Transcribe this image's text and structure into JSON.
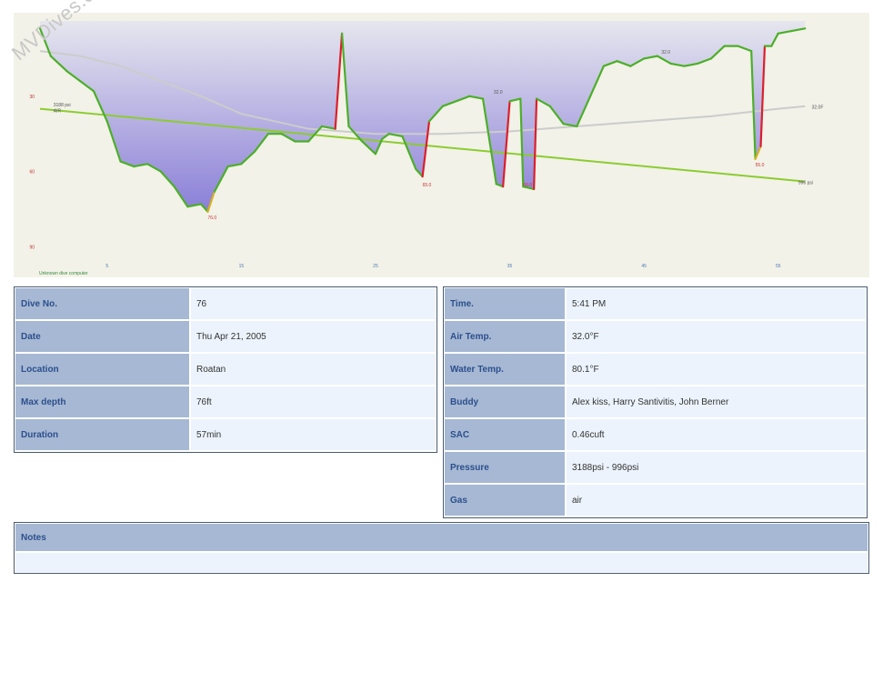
{
  "watermark": "MVDives.com",
  "chart_data": {
    "type": "line",
    "x_ticks": [
      5,
      15,
      25,
      35,
      45,
      55
    ],
    "y_ticks": [
      30,
      60,
      90
    ],
    "xlim": [
      0,
      58
    ],
    "ylim": [
      0,
      100
    ],
    "series": [
      {
        "kind": "depth",
        "x": [
          0,
          0.8,
          2,
          3,
          4,
          5,
          6,
          7,
          8,
          9,
          10,
          11,
          12,
          12.5,
          13,
          14,
          15,
          16,
          17,
          18,
          19,
          20,
          21,
          22,
          22.5,
          23,
          24,
          25,
          25.5,
          26,
          27,
          28,
          28.5,
          29,
          30,
          31,
          32,
          33,
          34,
          34.5,
          35,
          35.8,
          36,
          36.8,
          37,
          38,
          39,
          40,
          41,
          42,
          43,
          44,
          45,
          46,
          47,
          48,
          49,
          50,
          51,
          52,
          53,
          53.3,
          53.7,
          54,
          54.5,
          55,
          56,
          57
        ],
        "y": [
          3,
          14,
          20,
          24,
          28,
          40,
          56,
          58,
          57,
          60,
          66,
          74,
          73,
          76,
          68,
          58,
          57,
          52,
          45,
          45,
          48,
          48,
          42,
          43,
          5,
          42,
          48,
          53,
          47,
          45,
          46,
          59,
          62,
          40,
          34,
          32,
          30,
          31,
          65,
          66,
          32,
          31,
          66,
          67,
          31,
          34,
          41,
          42,
          30,
          18,
          16,
          18,
          15,
          14,
          17,
          18,
          17,
          15,
          10,
          10,
          12,
          55,
          50,
          10,
          10,
          5,
          4,
          3
        ]
      },
      {
        "kind": "pressure",
        "x": [
          0,
          57
        ],
        "y": [
          35,
          64
        ]
      },
      {
        "kind": "temperature",
        "x": [
          0,
          3,
          6,
          9,
          12,
          15,
          20,
          25,
          30,
          35,
          40,
          45,
          50,
          55,
          57
        ],
        "y": [
          12,
          14,
          18,
          24,
          30,
          37,
          43,
          45,
          45,
          44,
          42,
          40,
          38,
          35,
          34
        ]
      }
    ],
    "labels": [
      {
        "x": 1,
        "y": 34,
        "text": "3188 psi",
        "color": "#555555"
      },
      {
        "x": 1,
        "y": 36.5,
        "text": "AIR",
        "color": "#555555"
      },
      {
        "x": 12.5,
        "y": 79,
        "text": "76.0",
        "color": "#cc3333"
      },
      {
        "x": 28.5,
        "y": 66,
        "text": "65.0",
        "color": "#cc3333"
      },
      {
        "x": 36,
        "y": 66,
        "text": "66.0",
        "color": "#cc3333"
      },
      {
        "x": 53.3,
        "y": 58,
        "text": "55.0",
        "color": "#cc3333"
      },
      {
        "x": 56.5,
        "y": 65,
        "text": "996 psi",
        "color": "#555555"
      },
      {
        "x": 57.5,
        "y": 35,
        "text": "32.0F",
        "color": "#555555"
      },
      {
        "x": 33.8,
        "y": 29,
        "text": "32.0",
        "color": "#555555"
      },
      {
        "x": 46.3,
        "y": 13,
        "text": "32.0",
        "color": "#555555"
      }
    ],
    "footer": "Unknown dive computer",
    "colors": {
      "background": "#f2f2e8",
      "depth_fill_top": "#e0e0ea",
      "depth_fill_bottom": "#8c80d8",
      "depth_line": "#4caf28",
      "depth_line_dark": "#1e6b1e",
      "ascent_fast": "#dd1f2a",
      "ascent_mid": "#d8b020",
      "pressure": "#8ccc30",
      "temperature": "#cccccc",
      "axis_label": "#4a78b4",
      "axis_label_red": "#c03030"
    }
  },
  "dive_info": [
    {
      "label": "Dive No.",
      "value": "76"
    },
    {
      "label": "Date",
      "value": "Thu Apr 21, 2005"
    },
    {
      "label": "Location",
      "value": "Roatan"
    },
    {
      "label": "Max depth",
      "value": "76ft"
    },
    {
      "label": "Duration",
      "value": "57min"
    }
  ],
  "dive_details": [
    {
      "label": "Time.",
      "value": "5:41 PM"
    },
    {
      "label": "Air Temp.",
      "value": "32.0°F"
    },
    {
      "label": "Water Temp.",
      "value": "80.1°F"
    },
    {
      "label": "Buddy",
      "value": "Alex kiss, Harry Santivitis, John Berner"
    },
    {
      "label": "SAC",
      "value": "0.46cuft"
    },
    {
      "label": "Pressure",
      "value": "3188psi - 996psi"
    },
    {
      "label": "Gas",
      "value": "air"
    }
  ],
  "notes": {
    "label": "Notes",
    "value": ""
  }
}
